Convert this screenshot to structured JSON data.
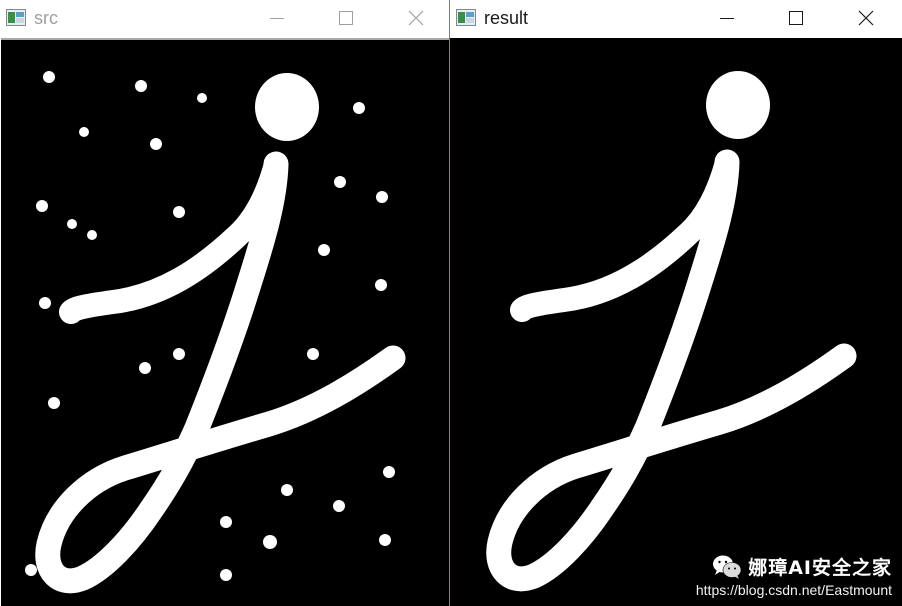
{
  "windows": [
    {
      "title": "src",
      "active": false
    },
    {
      "title": "result",
      "active": true
    }
  ],
  "titlebar_controls": [
    "minimize-icon",
    "maximize-icon",
    "close-icon"
  ],
  "watermark": {
    "name": "娜璋AI安全之家",
    "url": "https://blog.csdn.net/Eastmount",
    "icon": "wechat-icon"
  },
  "colors": {
    "image_background": "#000000",
    "glyph_fill": "#ffffff",
    "active_border": "#3c8fd6",
    "inactive_title": "#a0a0a0"
  },
  "content": {
    "src": "letter j with scattered white noise dots",
    "result": "letter j with noise removed"
  }
}
